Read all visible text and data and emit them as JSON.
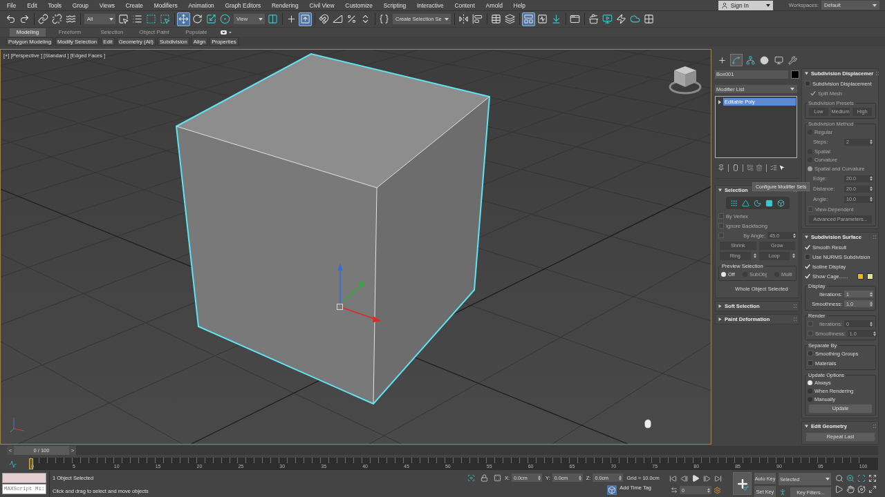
{
  "menu_bar": {
    "items": [
      "File",
      "Edit",
      "Tools",
      "Group",
      "Views",
      "Create",
      "Modifiers",
      "Animation",
      "Graph Editors",
      "Rendering",
      "Civil View",
      "Customize",
      "Scripting",
      "Interactive",
      "Content",
      "Arnold",
      "Help"
    ],
    "sign_in": "Sign In",
    "workspaces_label": "Workspaces:",
    "workspace": "Default"
  },
  "main_toolbar": {
    "groups": [
      [
        {
          "kind": "undo",
          "selected": false
        },
        {
          "kind": "redo",
          "selected": false
        }
      ],
      [
        {
          "kind": "link",
          "selected": false
        },
        {
          "kind": "unlink",
          "selected": false
        },
        {
          "kind": "bind",
          "selected": false
        }
      ],
      [
        {
          "kind": "dropdown",
          "value": "All"
        },
        {
          "kind": "selectobject",
          "selected": false
        },
        {
          "kind": "selectname",
          "selected": false
        },
        {
          "kind": "rectregion",
          "selected": false
        },
        {
          "kind": "crossing",
          "selected": false
        }
      ],
      [
        {
          "kind": "move",
          "selected": true
        },
        {
          "kind": "rotate",
          "selected": false
        },
        {
          "kind": "scale",
          "selected": false
        },
        {
          "kind": "place",
          "selected": false
        },
        {
          "kind": "dropdown",
          "value": "View"
        },
        {
          "kind": "pivot",
          "selected": false
        }
      ],
      [
        {
          "kind": "manipulate",
          "selected": false
        },
        {
          "kind": "override",
          "selected": true
        }
      ],
      [
        {
          "kind": "snap",
          "selected": false
        },
        {
          "kind": "anglesnap",
          "selected": false
        },
        {
          "kind": "percentsnap",
          "selected": false
        },
        {
          "kind": "spinnersnap",
          "selected": false
        }
      ],
      [
        {
          "kind": "namedsets",
          "selected": false
        },
        {
          "kind": "dropdown",
          "value": "Create Selection Se"
        }
      ],
      [
        {
          "kind": "mirror",
          "selected": false
        },
        {
          "kind": "align",
          "selected": false
        }
      ],
      [
        {
          "kind": "explorer",
          "selected": false
        },
        {
          "kind": "layers",
          "selected": false
        }
      ],
      [
        {
          "kind": "ribbon",
          "selected": true
        },
        {
          "kind": "curves",
          "selected": false
        },
        {
          "kind": "schematic",
          "selected": false
        }
      ],
      [
        {
          "kind": "material",
          "selected": false
        }
      ],
      [
        {
          "kind": "rendersetup",
          "selected": false
        },
        {
          "kind": "framewindow",
          "selected": false
        },
        {
          "kind": "render",
          "selected": false
        },
        {
          "kind": "cloud",
          "selected": false
        },
        {
          "kind": "compare",
          "selected": false
        }
      ]
    ]
  },
  "ribbon": {
    "tabs": [
      {
        "label": "Modeling",
        "selected": true
      },
      {
        "label": "Freeform",
        "selected": false
      },
      {
        "label": "Selection",
        "selected": false
      },
      {
        "label": "Object Paint",
        "selected": false
      },
      {
        "label": "Populate",
        "selected": false
      }
    ],
    "panels": [
      "Polygon Modeling",
      "Modify Selection",
      "Edit",
      "Geometry (All)",
      "Subdivision",
      "Align",
      "Properties"
    ]
  },
  "viewport": {
    "labels": [
      "[+]",
      "[Perspective ]",
      "[Standard ]",
      "[Edged Faces ]"
    ]
  },
  "command_panel": {
    "tabs": [
      {
        "kind": "create",
        "selected": false
      },
      {
        "kind": "modify",
        "selected": true
      },
      {
        "kind": "hierarchy",
        "selected": false
      },
      {
        "kind": "motion",
        "selected": false
      },
      {
        "kind": "display",
        "selected": false
      },
      {
        "kind": "utilities",
        "selected": false
      }
    ],
    "object_name": {
      "value": "Box001",
      "color": "#000000"
    },
    "modifier_list": "Modifier List",
    "stack": [
      {
        "label": "Editable Poly",
        "selected": true
      }
    ],
    "tooltip": "Configure Modifier Sets",
    "left_rollouts": [
      {
        "title": "Selection",
        "expanded": true,
        "controls": [
          {
            "kind": "subobjects",
            "items": [
              {
                "kind": "vertex",
                "selected": false
              },
              {
                "kind": "edge",
                "selected": false
              },
              {
                "kind": "border",
                "selected": false
              },
              {
                "kind": "polygon",
                "selected": false
              },
              {
                "kind": "element",
                "selected": false
              }
            ]
          },
          {
            "kind": "checkbox",
            "label": "By Vertex",
            "checked": false,
            "disabled": true
          },
          {
            "kind": "checkbox",
            "label": "Ignore Backfacing",
            "checked": false,
            "disabled": true
          },
          {
            "kind": "spinner",
            "label": "By Angle:",
            "value": "45.0",
            "checked": false,
            "disabled": true
          },
          {
            "kind": "buttons",
            "disabled": true,
            "items": [
              {
                "label": "Shrink",
                "spinner": false
              },
              {
                "label": "Grow",
                "spinner": false
              }
            ]
          },
          {
            "kind": "buttons",
            "disabled": true,
            "items": [
              {
                "label": "Ring",
                "spinner": true
              },
              {
                "label": "Loop",
                "spinner": true
              }
            ]
          },
          {
            "kind": "group",
            "title": "Preview Selection",
            "disabled": false,
            "controls": [
              {
                "kind": "radios",
                "options": [
                  {
                    "label": "Off",
                    "selected": true,
                    "disabled": false
                  },
                  {
                    "label": "SubObj",
                    "selected": false,
                    "disabled": true
                  },
                  {
                    "label": "Multi",
                    "selected": false,
                    "disabled": true
                  }
                ]
              }
            ]
          },
          {
            "kind": "text",
            "label": "Whole Object Selected"
          }
        ]
      },
      {
        "title": "Soft Selection",
        "expanded": false
      },
      {
        "title": "Paint Deformation",
        "expanded": false
      }
    ],
    "right_rollouts": [
      {
        "title": "Subdivision Displacemer",
        "expanded": true,
        "controls": [
          {
            "kind": "checkbox",
            "label": "Subdivision Displacement",
            "checked": false,
            "disabled": false,
            "children": [
              {
                "kind": "checkbox",
                "label": "Split Mesh",
                "checked": true,
                "disabled": true
              }
            ]
          },
          {
            "kind": "group",
            "title": "Subdivision Presets",
            "disabled": true,
            "controls": [
              {
                "kind": "buttons",
                "disabled": true,
                "items": [
                  {
                    "label": "Low"
                  },
                  {
                    "label": "Medium"
                  },
                  {
                    "label": "High"
                  }
                ]
              }
            ]
          },
          {
            "kind": "group",
            "title": "Subdivision Method",
            "disabled": true,
            "controls": [
              {
                "kind": "radio",
                "label": "Regular",
                "selected": false,
                "disabled": true,
                "children": [
                  {
                    "kind": "spinner",
                    "label": "Steps:",
                    "value": "2",
                    "disabled": true
                  }
                ]
              },
              {
                "kind": "radio",
                "label": "Spatial",
                "selected": false,
                "disabled": true
              },
              {
                "kind": "radio",
                "label": "Curvature",
                "selected": false,
                "disabled": true
              },
              {
                "kind": "radio",
                "label": "Spatial and Curvature",
                "selected": true,
                "disabled": true,
                "children": [
                  {
                    "kind": "spinner",
                    "label": "Edge:",
                    "value": "20.0",
                    "disabled": true
                  },
                  {
                    "kind": "spinner",
                    "label": "Distance:",
                    "value": "20.0",
                    "disabled": true
                  },
                  {
                    "kind": "spinner",
                    "label": "Angle:",
                    "value": "10.0",
                    "disabled": true
                  }
                ]
              },
              {
                "kind": "checkbox",
                "label": "View-Dependent",
                "checked": false,
                "disabled": true
              },
              {
                "kind": "buttons",
                "disabled": true,
                "items": [
                  {
                    "label": "Advanced Parameters..."
                  }
                ]
              }
            ]
          }
        ]
      },
      {
        "title": "Subdivision Surface",
        "expanded": true,
        "controls": [
          {
            "kind": "checkbox",
            "label": "Smooth Result",
            "checked": true,
            "disabled": false
          },
          {
            "kind": "checkbox",
            "label": "Use NURMS Subdivision",
            "checked": false,
            "disabled": false
          },
          {
            "kind": "checkbox",
            "label": "Isoline Display",
            "checked": true,
            "disabled": false
          },
          {
            "kind": "checkbox",
            "label": "Show Cage......",
            "checked": true,
            "disabled": false,
            "swatches": [
              {
                "color": "#f2b705"
              },
              {
                "color": "#e4e48e"
              }
            ]
          },
          {
            "kind": "group",
            "title": "Display",
            "disabled": false,
            "controls": [
              {
                "kind": "spinner",
                "label": "Iterations:",
                "value": "1",
                "disabled": false
              },
              {
                "kind": "spinner",
                "label": "Smoothness:",
                "value": "1.0",
                "disabled": false
              }
            ]
          },
          {
            "kind": "group",
            "title": "Render",
            "disabled": false,
            "controls": [
              {
                "kind": "spinner",
                "label": "Iterations:",
                "value": "0",
                "checked": false,
                "disabled": true
              },
              {
                "kind": "spinner",
                "label": "Smoothness:",
                "value": "1.0",
                "checked": false,
                "disabled": true
              }
            ]
          },
          {
            "kind": "group",
            "title": "Separate By",
            "disabled": false,
            "controls": [
              {
                "kind": "checkbox",
                "label": "Smoothing Groups",
                "checked": false,
                "disabled": false
              },
              {
                "kind": "checkbox",
                "label": "Materials",
                "checked": false,
                "disabled": false
              }
            ]
          },
          {
            "kind": "group",
            "title": "Update Options",
            "disabled": false,
            "controls": [
              {
                "kind": "radio",
                "label": "Always",
                "selected": true,
                "disabled": false
              },
              {
                "kind": "radio",
                "label": "When Rendering",
                "selected": false,
                "disabled": false
              },
              {
                "kind": "radio",
                "label": "Manually",
                "selected": false,
                "disabled": false
              },
              {
                "kind": "buttons",
                "disabled": false,
                "items": [
                  {
                    "label": "Update"
                  }
                ]
              }
            ]
          }
        ]
      },
      {
        "title": "Edit Geometry",
        "expanded": true,
        "controls": [
          {
            "kind": "buttons",
            "disabled": false,
            "items": [
              {
                "label": "Repeat Last"
              }
            ]
          }
        ]
      }
    ]
  },
  "time_slider": {
    "prev": "<",
    "label": "0 / 100",
    "next": ">",
    "level": 0
  },
  "track_bar": {
    "labels": [
      "0",
      "5",
      "10",
      "15",
      "20",
      "25",
      "30",
      "35",
      "40",
      "45",
      "50",
      "55",
      "60",
      "65",
      "70",
      "75",
      "80",
      "85",
      "90",
      "95",
      "100"
    ]
  },
  "status_bar": {
    "listener_output": "MAXScript Mi:",
    "selection_info": "1 Object Selected",
    "prompt": "Click and drag to select and move objects",
    "coordinates": [
      {
        "axis": "X:",
        "value": "0.0cm"
      },
      {
        "axis": "Y:",
        "value": "0.0cm"
      },
      {
        "axis": "Z:",
        "value": "0.0cm"
      }
    ],
    "grid": "Grid = 10.0cm",
    "time_tag": "Add Time Tag",
    "frame": "0",
    "auto_key": "Auto Key",
    "set_key": "Set Key",
    "key_set": "Selected",
    "key_filters": "Key Filters..."
  }
}
